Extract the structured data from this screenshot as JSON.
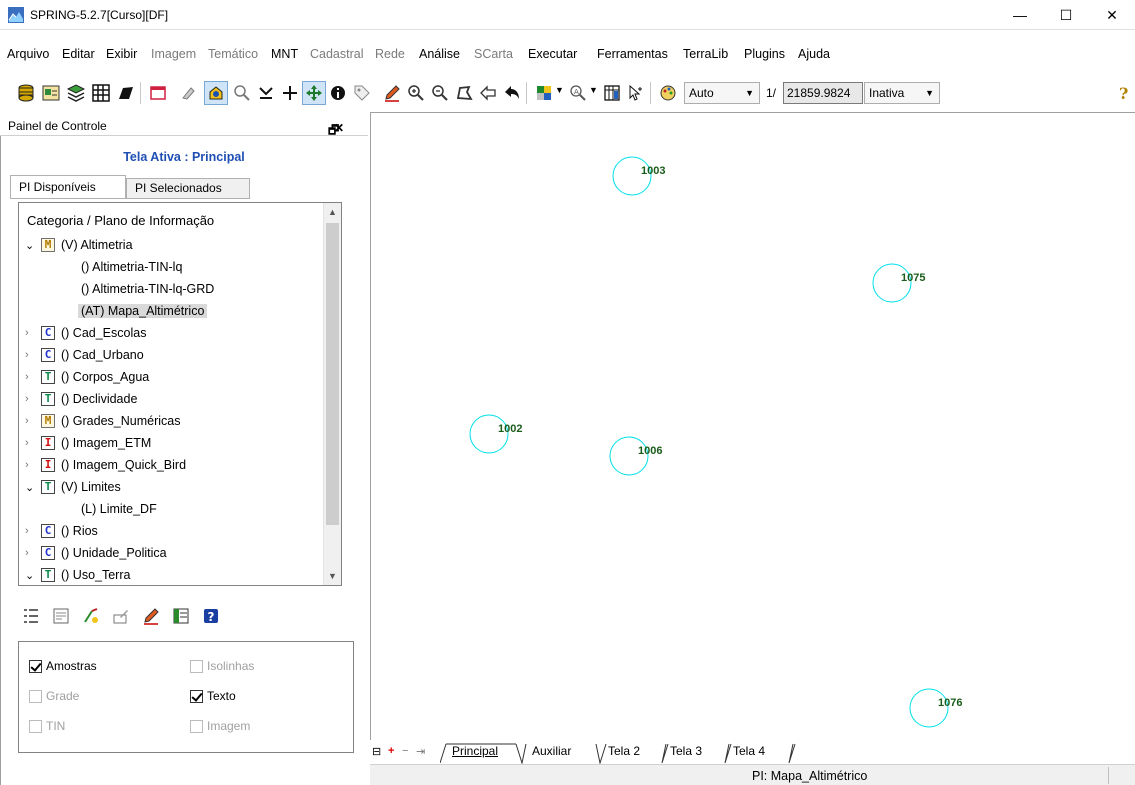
{
  "window": {
    "title": "SPRING-5.2.7[Curso][DF]",
    "minimize": "—",
    "maximize": "☐",
    "close": "✕"
  },
  "menu": [
    {
      "label": "Arquivo",
      "enabled": true
    },
    {
      "label": "Editar",
      "enabled": true
    },
    {
      "label": "Exibir",
      "enabled": true
    },
    {
      "label": "Imagem",
      "enabled": false
    },
    {
      "label": "Temático",
      "enabled": false
    },
    {
      "label": "MNT",
      "enabled": true
    },
    {
      "label": "Cadastral",
      "enabled": false
    },
    {
      "label": "Rede",
      "enabled": false
    },
    {
      "label": "Análise",
      "enabled": true
    },
    {
      "label": "SCarta",
      "enabled": false
    },
    {
      "label": "Executar",
      "enabled": true
    },
    {
      "label": "Ferramentas",
      "enabled": true
    },
    {
      "label": "TerraLib",
      "enabled": true
    },
    {
      "label": "Plugins",
      "enabled": true
    },
    {
      "label": "Ajuda",
      "enabled": true
    }
  ],
  "toolbar": {
    "zoom_mode": "Auto",
    "scale_prefix": "1/",
    "scale_value": "21859.9824",
    "state": "Inativa"
  },
  "panel": {
    "title": "Painel de Controle",
    "tela_ativa": "Tela Ativa : Principal",
    "tabs": [
      "PI Disponíveis",
      "PI Selecionados"
    ],
    "tree_header": "Categoria / Plano de Informação",
    "tree": [
      {
        "kind": "category",
        "cat": "M",
        "label": "(V) Altimetria",
        "expanded": true
      },
      {
        "kind": "pi",
        "label": "() Altimetria-TIN-lq"
      },
      {
        "kind": "pi",
        "label": "() Altimetria-TIN-lq-GRD"
      },
      {
        "kind": "pi",
        "label": "(AT) Mapa_Altimétrico",
        "selected": true
      },
      {
        "kind": "category",
        "cat": "C",
        "label": "() Cad_Escolas",
        "expanded": false
      },
      {
        "kind": "category",
        "cat": "C",
        "label": "() Cad_Urbano",
        "expanded": false
      },
      {
        "kind": "category",
        "cat": "T",
        "label": "() Corpos_Agua",
        "expanded": false
      },
      {
        "kind": "category",
        "cat": "T",
        "label": "() Declividade",
        "expanded": false
      },
      {
        "kind": "category",
        "cat": "M",
        "label": "() Grades_Numéricas",
        "expanded": false
      },
      {
        "kind": "category",
        "cat": "I",
        "label": "() Imagem_ETM",
        "expanded": false
      },
      {
        "kind": "category",
        "cat": "I",
        "label": "() Imagem_Quick_Bird",
        "expanded": false
      },
      {
        "kind": "category",
        "cat": "T",
        "label": "(V) Limites",
        "expanded": true
      },
      {
        "kind": "pi",
        "label": "(L) Limite_DF"
      },
      {
        "kind": "category",
        "cat": "C",
        "label": "() Rios",
        "expanded": false
      },
      {
        "kind": "category",
        "cat": "C",
        "label": "() Unidade_Politica",
        "expanded": false
      },
      {
        "kind": "category",
        "cat": "T",
        "label": "() Uso_Terra",
        "expanded": true
      }
    ],
    "options": {
      "amostras": {
        "label": "Amostras",
        "checked": true,
        "enabled": true
      },
      "isolinhas": {
        "label": "Isolinhas",
        "checked": false,
        "enabled": false
      },
      "grade": {
        "label": "Grade",
        "checked": false,
        "enabled": false
      },
      "texto": {
        "label": "Texto",
        "checked": true,
        "enabled": true
      },
      "tin": {
        "label": "TIN",
        "checked": false,
        "enabled": false
      },
      "imagem": {
        "label": "Imagem",
        "checked": false,
        "enabled": false
      }
    }
  },
  "canvas": {
    "samples": [
      {
        "label": "1003"
      },
      {
        "label": "1075"
      },
      {
        "label": "1002"
      },
      {
        "label": "1006"
      },
      {
        "label": "1076"
      }
    ],
    "sample_color": "#00e0e8",
    "label_color": "#1a5c1a"
  },
  "bottom_tabs": {
    "tabs": [
      "Principal",
      "Auxiliar",
      "Tela 2",
      "Tela 3",
      "Tela 4"
    ],
    "active": "Principal"
  },
  "status": {
    "pi": "PI: Mapa_Altimétrico"
  }
}
